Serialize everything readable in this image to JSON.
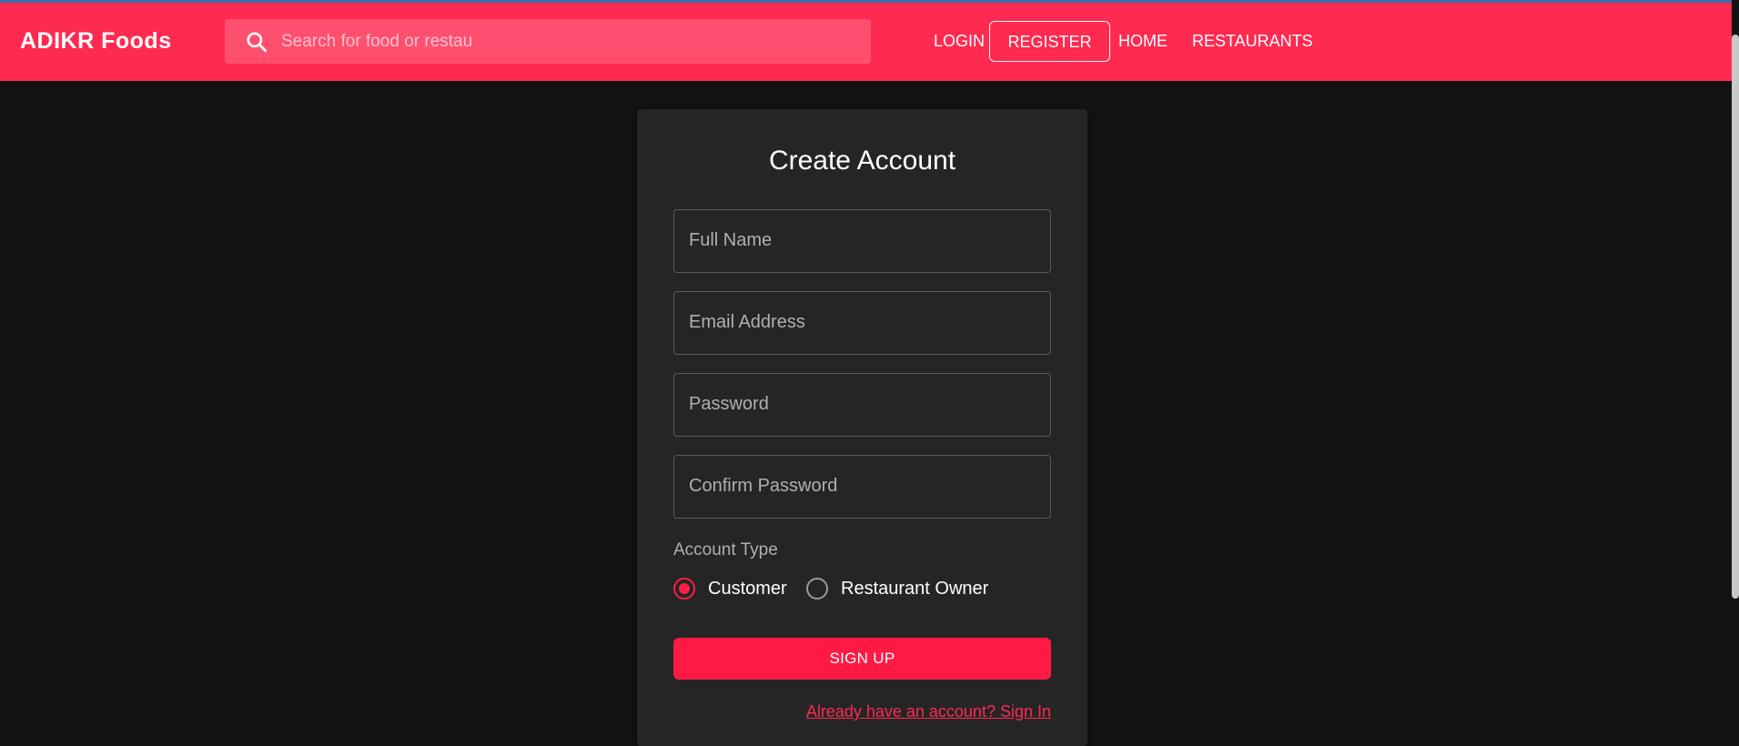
{
  "header": {
    "brand": "ADIKR Foods",
    "search_placeholder": "Search for food or restau",
    "nav": {
      "login": "LOGIN",
      "register": "REGISTER",
      "home": "HOME",
      "restaurants": "RESTAURANTS"
    },
    "icon": "search-icon"
  },
  "form": {
    "title": "Create Account",
    "fields": {
      "full_name": "Full Name",
      "email": "Email Address",
      "password": "Password",
      "confirm_password": "Confirm Password"
    },
    "account_type_label": "Account Type",
    "account_types": [
      {
        "label": "Customer",
        "selected": true
      },
      {
        "label": "Restaurant Owner",
        "selected": false
      }
    ],
    "submit_label": "SIGN UP",
    "signin_link": "Already have an account? Sign In"
  },
  "colors": {
    "accent": "#ff2a50",
    "button": "#ff1a44",
    "background": "#121212",
    "card": "#252525"
  }
}
